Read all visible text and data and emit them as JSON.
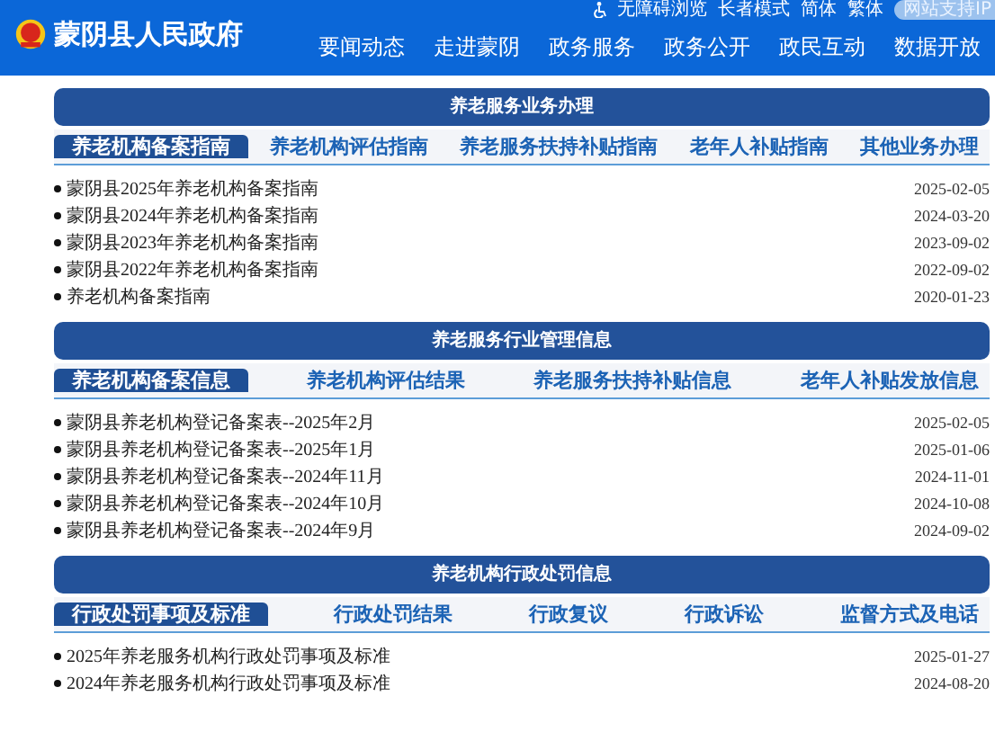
{
  "header": {
    "site_title": "蒙阴县人民政府",
    "utility_links": [
      "无障碍浏览",
      "长者模式",
      "简体",
      "繁体"
    ],
    "ipv6_badge": "网站支持IP",
    "nav": [
      "要闻动态",
      "走进蒙阴",
      "政务服务",
      "政务公开",
      "政民互动",
      "数据开放"
    ]
  },
  "sections": [
    {
      "title": "养老服务业务办理",
      "tabs": [
        {
          "label": "养老机构备案指南",
          "selected": true
        },
        {
          "label": "养老机构评估指南",
          "selected": false
        },
        {
          "label": "养老服务扶持补贴指南",
          "selected": false
        },
        {
          "label": "老年人补贴指南",
          "selected": false
        },
        {
          "label": "其他业务办理",
          "selected": false
        }
      ],
      "items": [
        {
          "title": "蒙阴县2025年养老机构备案指南",
          "date": "2025-02-05"
        },
        {
          "title": "蒙阴县2024年养老机构备案指南",
          "date": "2024-03-20"
        },
        {
          "title": "蒙阴县2023年养老机构备案指南",
          "date": "2023-09-02"
        },
        {
          "title": "蒙阴县2022年养老机构备案指南",
          "date": "2022-09-02"
        },
        {
          "title": "养老机构备案指南",
          "date": "2020-01-23"
        }
      ]
    },
    {
      "title": "养老服务行业管理信息",
      "tabs": [
        {
          "label": "养老机构备案信息",
          "selected": true
        },
        {
          "label": "养老机构评估结果",
          "selected": false
        },
        {
          "label": "养老服务扶持补贴信息",
          "selected": false
        },
        {
          "label": "老年人补贴发放信息",
          "selected": false
        }
      ],
      "items": [
        {
          "title": "蒙阴县养老机构登记备案表--2025年2月",
          "date": "2025-02-05"
        },
        {
          "title": "蒙阴县养老机构登记备案表--2025年1月",
          "date": "2025-01-06"
        },
        {
          "title": "蒙阴县养老机构登记备案表--2024年11月",
          "date": "2024-11-01"
        },
        {
          "title": "蒙阴县养老机构登记备案表--2024年10月",
          "date": "2024-10-08"
        },
        {
          "title": "蒙阴县养老机构登记备案表--2024年9月",
          "date": "2024-09-02"
        }
      ]
    },
    {
      "title": "养老机构行政处罚信息",
      "tabs": [
        {
          "label": "行政处罚事项及标准",
          "selected": true
        },
        {
          "label": "行政处罚结果",
          "selected": false
        },
        {
          "label": "行政复议",
          "selected": false
        },
        {
          "label": "行政诉讼",
          "selected": false
        },
        {
          "label": "监督方式及电话",
          "selected": false
        }
      ],
      "items": [
        {
          "title": "2025年养老服务机构行政处罚事项及标准",
          "date": "2025-01-27"
        },
        {
          "title": "2024年养老服务机构行政处罚事项及标准",
          "date": "2024-08-20"
        }
      ]
    }
  ]
}
